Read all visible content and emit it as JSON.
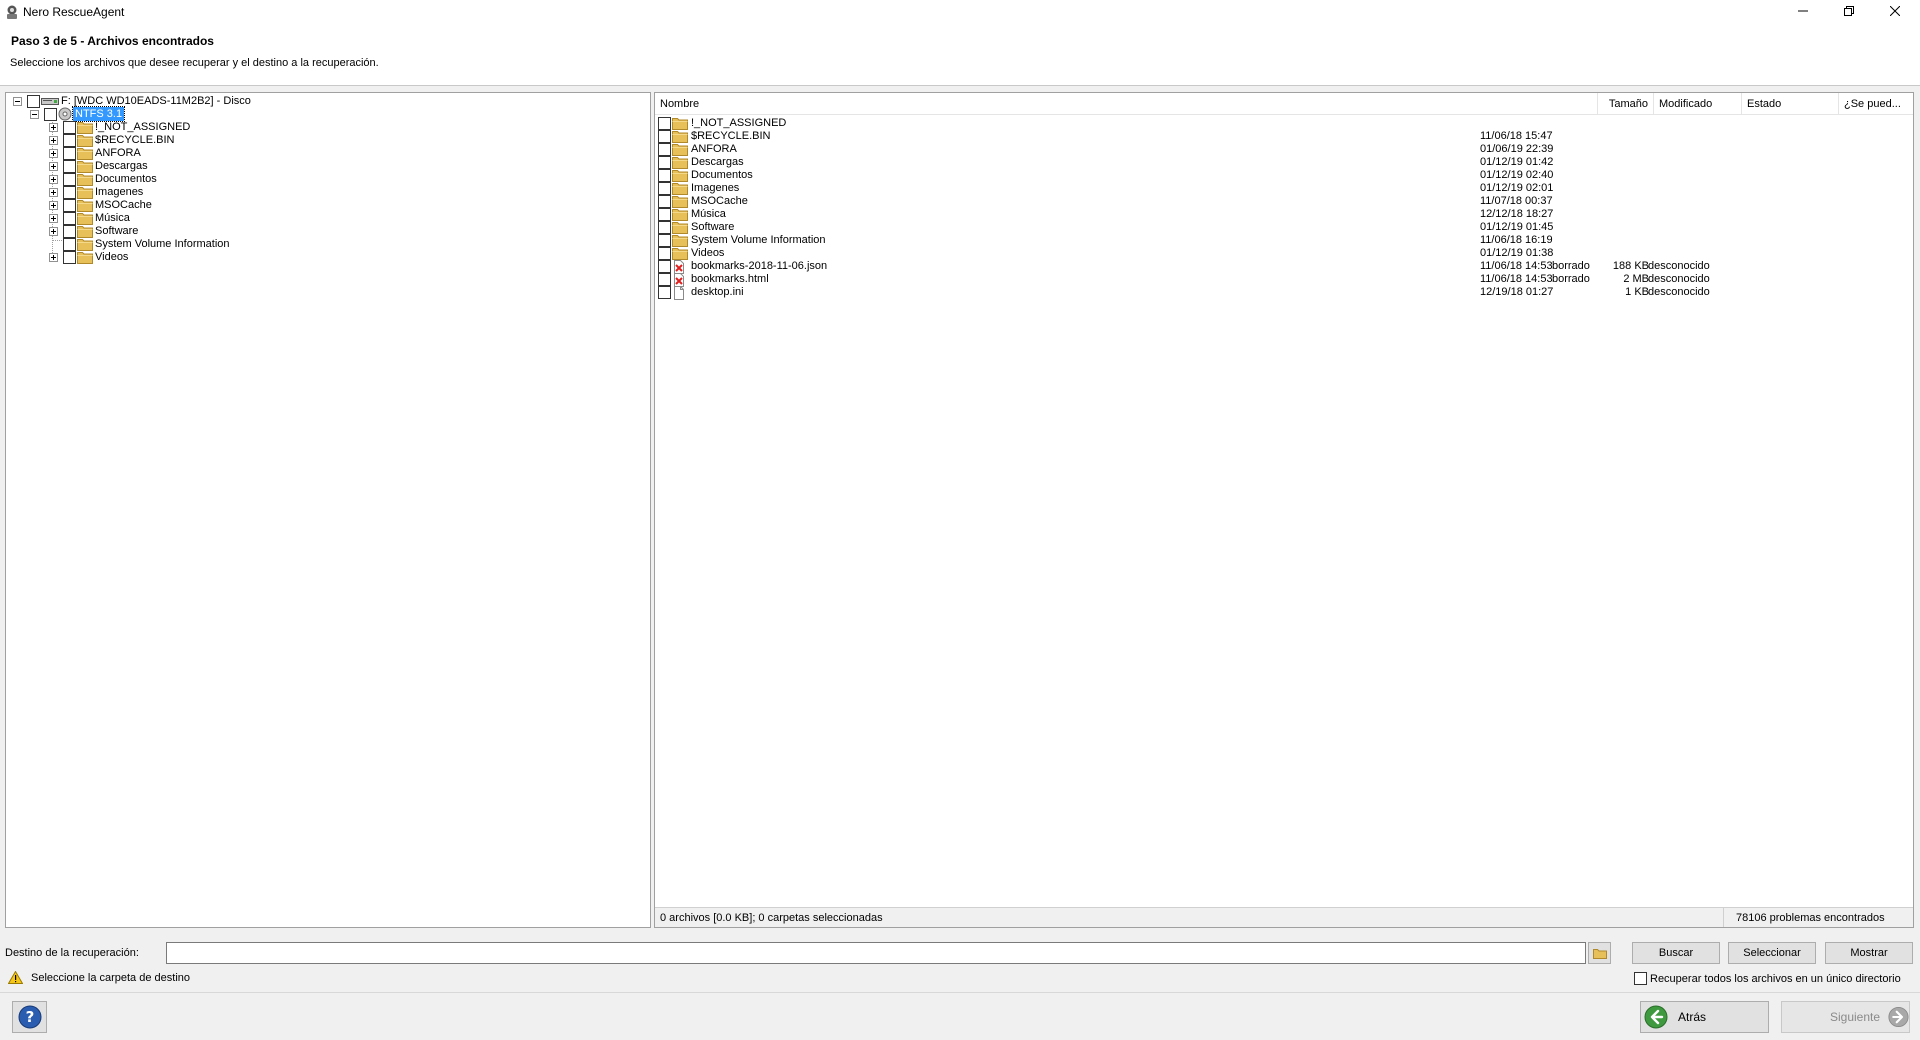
{
  "window": {
    "title": "Nero RescueAgent"
  },
  "header": {
    "step_title": "Paso 3 de 5 - Archivos encontrados",
    "subtitle": "Seleccione los archivos que desee recuperar y el destino a la recuperación."
  },
  "tree": {
    "disk_label": "F: [WDC WD10EADS-11M2B2] - Disco",
    "partition_label": "NTFS 3.1",
    "folders": [
      {
        "label": "!_NOT_ASSIGNED",
        "expandable": true
      },
      {
        "label": "$RECYCLE.BIN",
        "expandable": true
      },
      {
        "label": "ANFORA",
        "expandable": true
      },
      {
        "label": "Descargas",
        "expandable": true
      },
      {
        "label": "Documentos",
        "expandable": true
      },
      {
        "label": "Imagenes",
        "expandable": true
      },
      {
        "label": "MSOCache",
        "expandable": true
      },
      {
        "label": "Música",
        "expandable": true
      },
      {
        "label": "Software",
        "expandable": true
      },
      {
        "label": "System Volume Information",
        "expandable": false
      },
      {
        "label": "Videos",
        "expandable": true
      }
    ]
  },
  "list": {
    "columns": {
      "name": "Nombre",
      "size": "Tamaño",
      "modified": "Modificado",
      "state": "Estado",
      "recoverable": "¿Se pued..."
    },
    "rows": [
      {
        "icon": "folder-icon",
        "name": "!_NOT_ASSIGNED",
        "size": "",
        "modified": "",
        "state": "",
        "recoverable": ""
      },
      {
        "icon": "folder-icon",
        "name": "$RECYCLE.BIN",
        "size": "",
        "modified": "11/06/18 15:47",
        "state": "",
        "recoverable": ""
      },
      {
        "icon": "folder-icon",
        "name": "ANFORA",
        "size": "",
        "modified": "01/06/19 22:39",
        "state": "",
        "recoverable": ""
      },
      {
        "icon": "folder-icon",
        "name": "Descargas",
        "size": "",
        "modified": "01/12/19 01:42",
        "state": "",
        "recoverable": ""
      },
      {
        "icon": "folder-icon",
        "name": "Documentos",
        "size": "",
        "modified": "01/12/19 02:40",
        "state": "",
        "recoverable": ""
      },
      {
        "icon": "folder-icon",
        "name": "Imagenes",
        "size": "",
        "modified": "01/12/19 02:01",
        "state": "",
        "recoverable": ""
      },
      {
        "icon": "folder-icon",
        "name": "MSOCache",
        "size": "",
        "modified": "11/07/18 00:37",
        "state": "",
        "recoverable": ""
      },
      {
        "icon": "folder-icon",
        "name": "Música",
        "size": "",
        "modified": "12/12/18 18:27",
        "state": "",
        "recoverable": ""
      },
      {
        "icon": "folder-icon",
        "name": "Software",
        "size": "",
        "modified": "01/12/19 01:45",
        "state": "",
        "recoverable": ""
      },
      {
        "icon": "folder-icon",
        "name": "System Volume Information",
        "size": "",
        "modified": "11/06/18 16:19",
        "state": "",
        "recoverable": ""
      },
      {
        "icon": "folder-icon",
        "name": "Videos",
        "size": "",
        "modified": "01/12/19 01:38",
        "state": "",
        "recoverable": ""
      },
      {
        "icon": "deleted-file-icon",
        "name": "bookmarks-2018-11-06.json",
        "size": "188 KB",
        "modified": "11/06/18 14:53",
        "state": "borrado",
        "recoverable": "desconocido"
      },
      {
        "icon": "deleted-file-icon",
        "name": "bookmarks.html",
        "size": "2 MB",
        "modified": "11/06/18 14:53",
        "state": "borrado",
        "recoverable": "desconocido"
      },
      {
        "icon": "file-icon",
        "name": "desktop.ini",
        "size": "1 KB",
        "modified": "12/19/18 01:27",
        "state": "",
        "recoverable": "desconocido"
      }
    ],
    "status_left": "0 archivos [0.0 KB]; 0 carpetas seleccionadas",
    "status_right": "78106 problemas encontrados"
  },
  "destination": {
    "label": "Destino de la recuperación:",
    "value": "",
    "search_button": "Buscar",
    "select_button": "Seleccionar",
    "show_button": "Mostrar",
    "warning": "Seleccione la carpeta de destino",
    "single_dir_label": "Recuperar todos los archivos en un único directorio"
  },
  "nav": {
    "back": "Atrás",
    "next": "Siguiente"
  },
  "colors": {
    "selection": "#3399ff",
    "folder": "#e8c05a",
    "deleted_mark": "#e02020",
    "nav_arrow": "#3f9a3f"
  }
}
